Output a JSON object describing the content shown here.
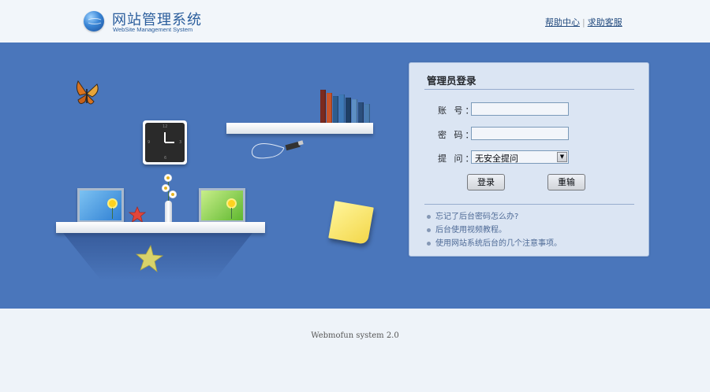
{
  "header": {
    "title": "网站管理系统",
    "subtitle": "WebSite Management System",
    "links": [
      {
        "label": "帮助中心"
      },
      {
        "label": "求助客服"
      }
    ],
    "separator": "|"
  },
  "login": {
    "title": "管理员登录",
    "fields": {
      "account_label": "账 号：",
      "account_value": "",
      "password_label": "密 码：",
      "password_value": "",
      "question_label": "提 问：",
      "question_value": "无安全提问"
    },
    "buttons": {
      "login": "登录",
      "reset": "重输"
    },
    "tips": [
      "忘记了后台密码怎么办?",
      "后台使用视频教程。",
      "使用网站系统后台的几个注意事项。"
    ]
  },
  "footer": {
    "text": "Webmofun system 2.0"
  },
  "colors": {
    "band": "#4a76bb",
    "header_bg": "#f2f6fa",
    "panel_bg": "#e7eef8",
    "link": "#224a7e"
  },
  "icons": [
    "globe-icon",
    "butterfly-icon",
    "clock-icon",
    "books-icon",
    "picture-frame-icon",
    "star-icon",
    "sticky-note-icon",
    "flower-vase-icon",
    "dropdown-arrow-icon"
  ]
}
